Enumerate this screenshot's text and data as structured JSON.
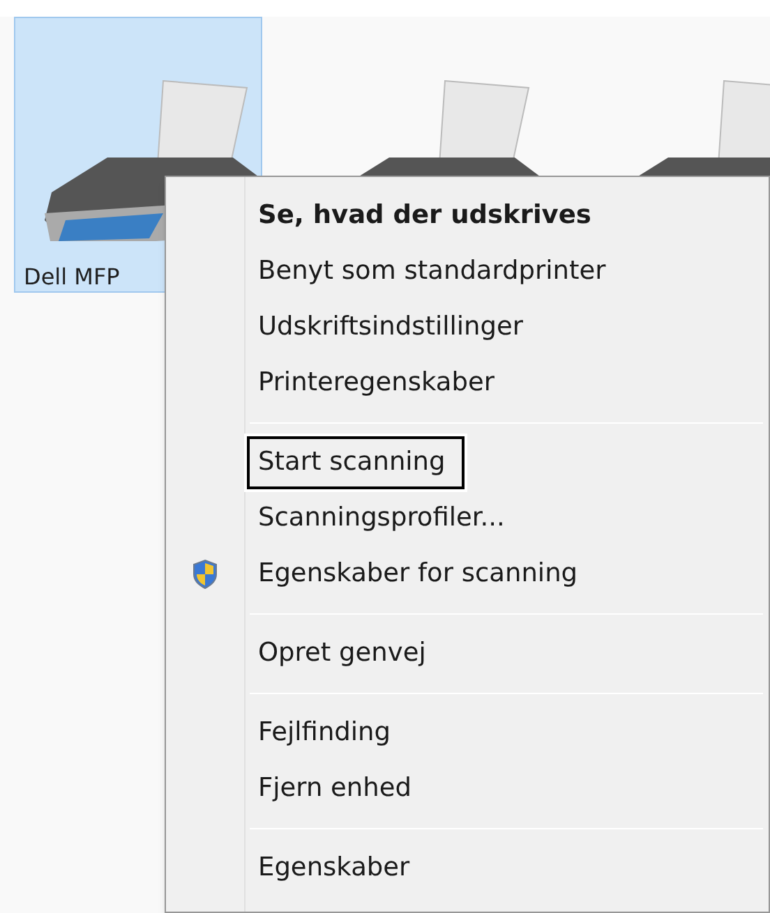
{
  "devices": [
    {
      "label": "Dell MFP",
      "selected": true
    },
    {
      "selected": false
    },
    {
      "selected": false
    }
  ],
  "context_menu": {
    "items": [
      {
        "kind": "item",
        "label": "Se, hvad der udskrives",
        "default": true
      },
      {
        "kind": "item",
        "label": "Benyt som standardprinter"
      },
      {
        "kind": "item",
        "label": "Udskriftsindstillinger"
      },
      {
        "kind": "item",
        "label": "Printeregenskaber"
      },
      {
        "kind": "separator"
      },
      {
        "kind": "item",
        "label": "Start scanning",
        "outlined": true
      },
      {
        "kind": "item",
        "label": "Scanningsprofiler..."
      },
      {
        "kind": "item",
        "label": "Egenskaber for scanning",
        "shield": true
      },
      {
        "kind": "separator"
      },
      {
        "kind": "item",
        "label": "Opret genvej"
      },
      {
        "kind": "separator"
      },
      {
        "kind": "item",
        "label": "Fejlfinding"
      },
      {
        "kind": "item",
        "label": "Fjern enhed"
      },
      {
        "kind": "separator"
      },
      {
        "kind": "item",
        "label": "Egenskaber"
      }
    ]
  }
}
